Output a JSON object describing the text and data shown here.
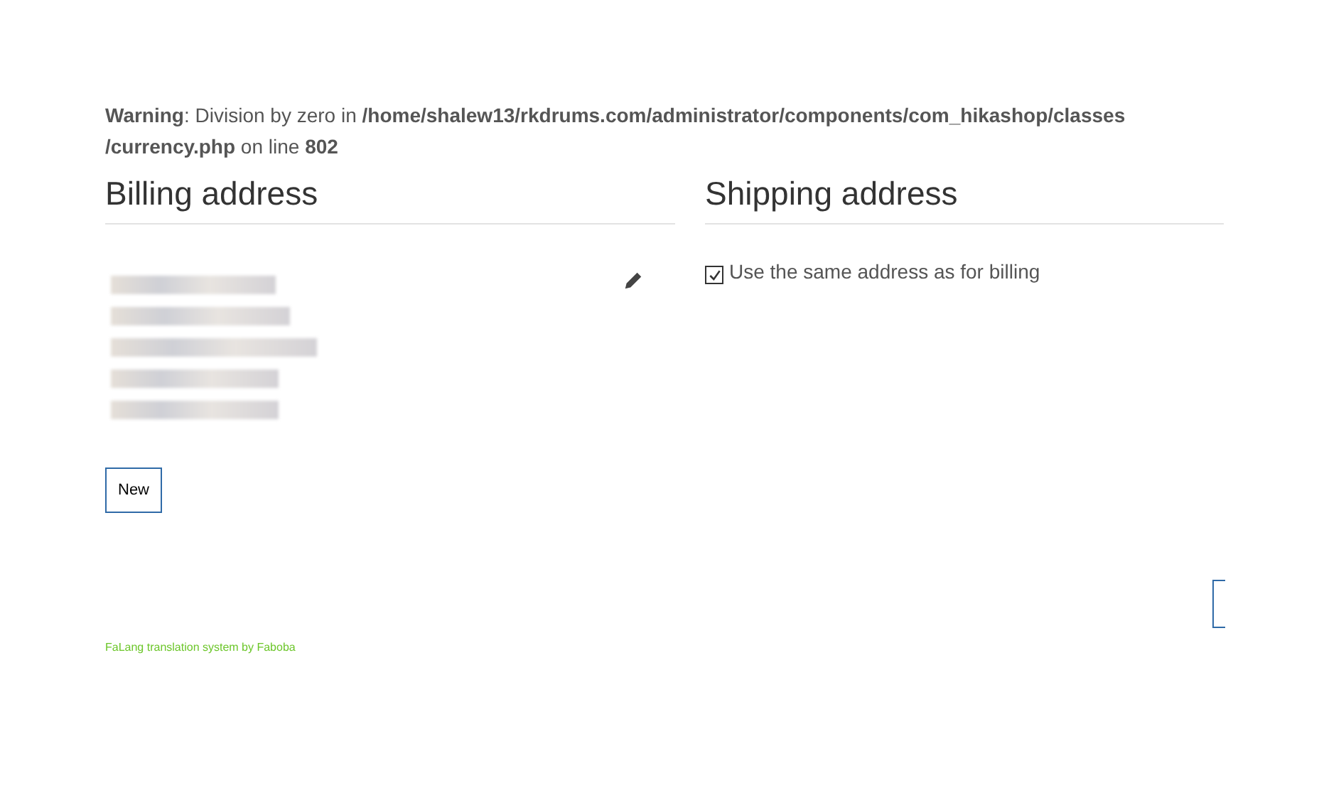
{
  "warning": "**Warning**: Division by zero in **/home/shalew13/rkdrums.com/administrator/components/com_hikashop/classes /currency.php** on line **802**",
  "billing": {
    "title": "Billing address",
    "new_button": "New"
  },
  "shipping": {
    "title": "Shipping address",
    "same_as_billing": {
      "label": "Use the same address as for billing",
      "checked": true
    }
  },
  "footer": "FaLang translation system by Faboba"
}
